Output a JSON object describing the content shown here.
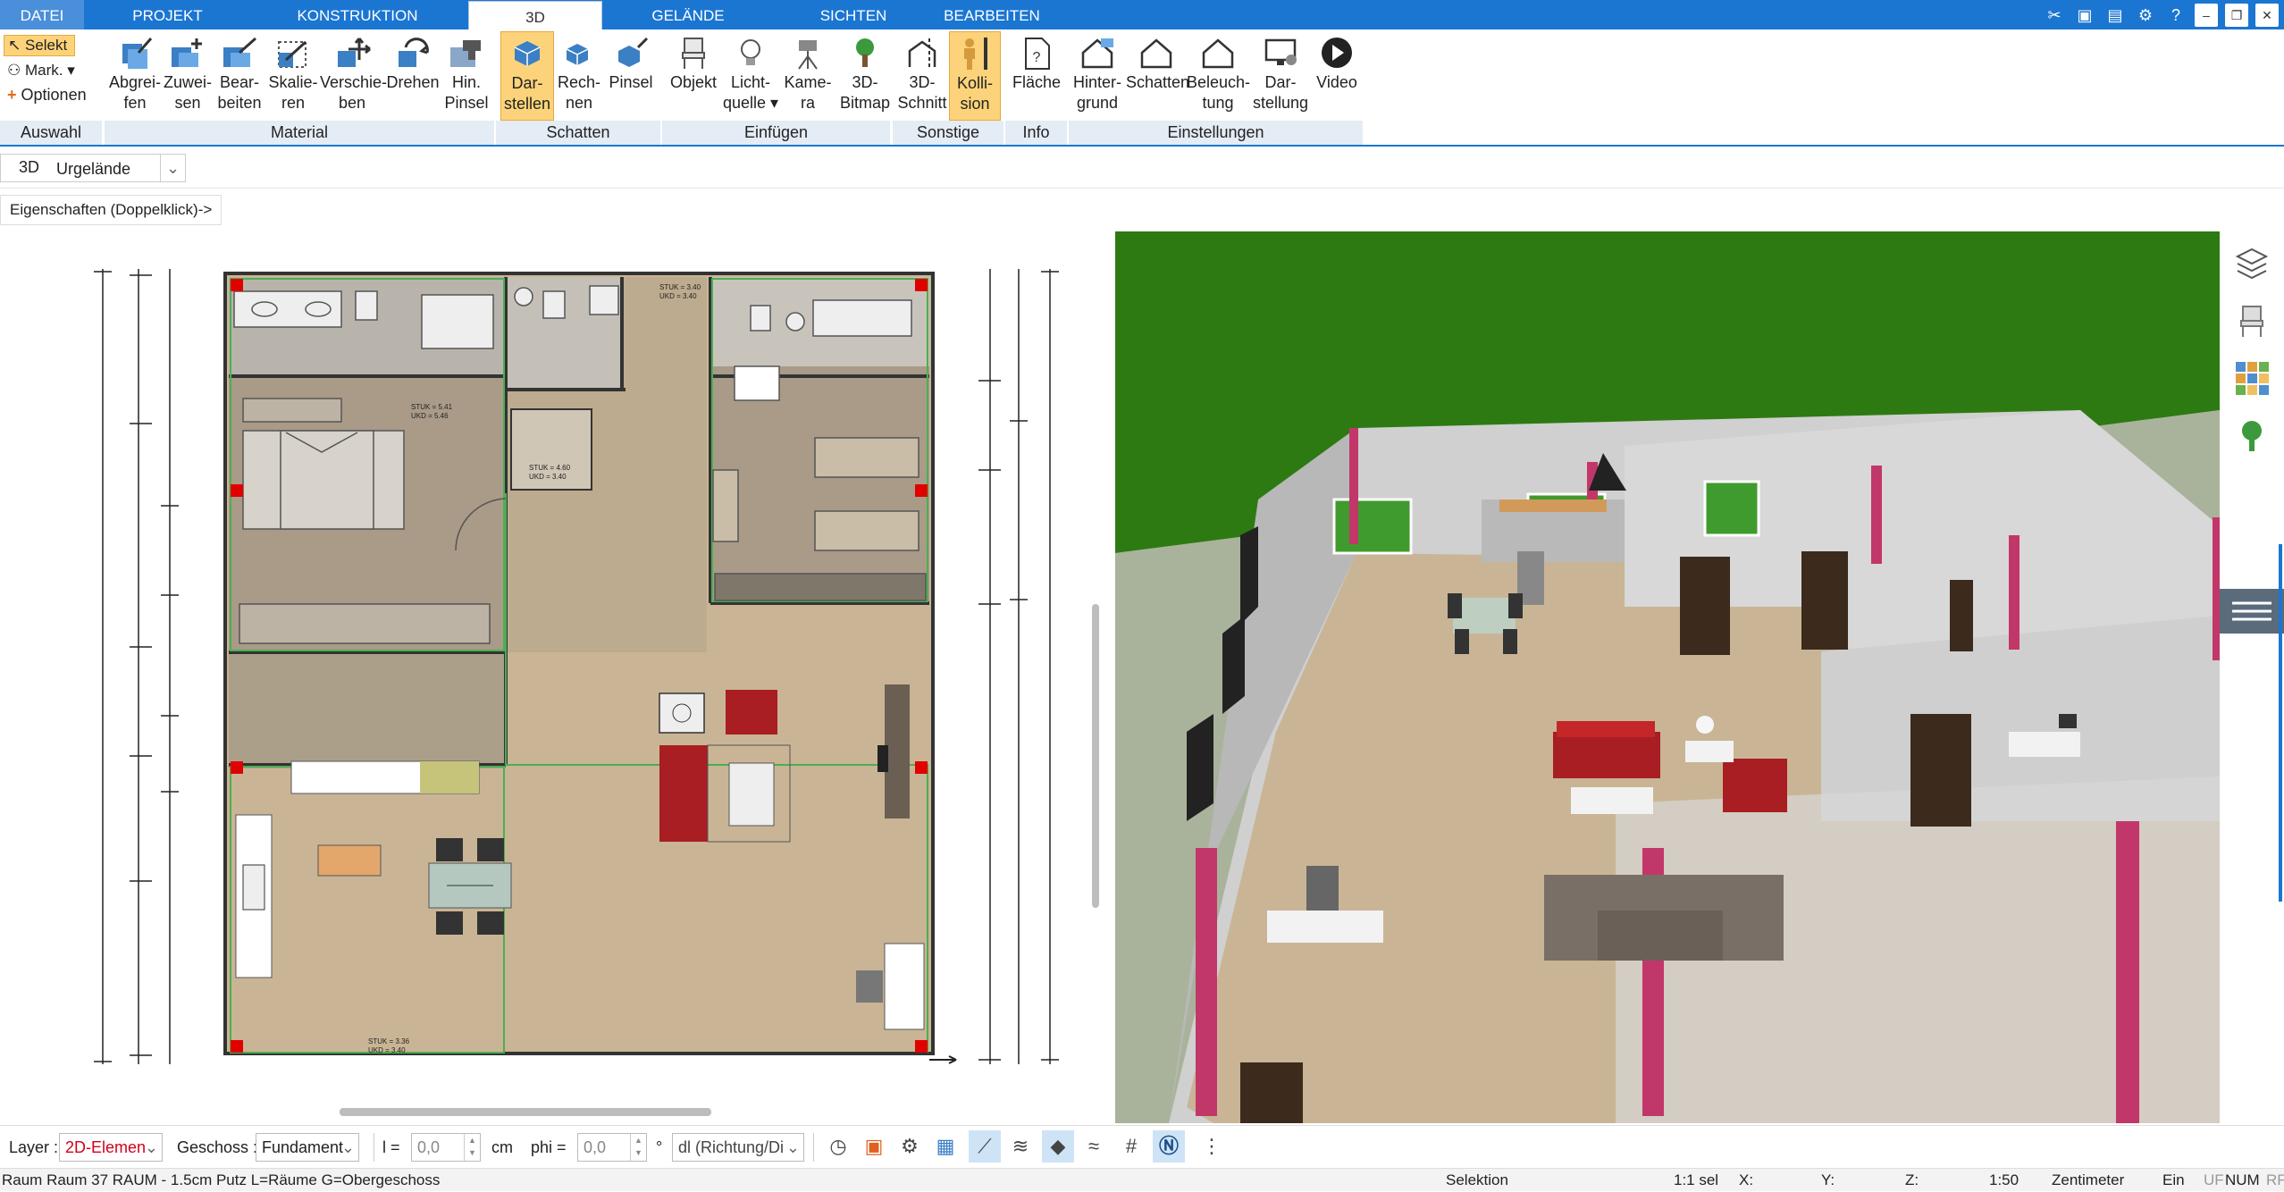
{
  "tabs": {
    "file": "DATEI",
    "projekt": "PROJEKT",
    "konstruktion": "KONSTRUKTION",
    "d3": "3D",
    "gelaende": "GELÄNDE",
    "sichten": "SICHTEN",
    "bearbeiten": "BEARBEITEN"
  },
  "auswahl": {
    "selekt": "Selekt",
    "mark": "Mark.",
    "optionen": "Optionen",
    "group": "Auswahl"
  },
  "material": {
    "b1a": "Abgrei-",
    "b1b": "fen",
    "b2a": "Zuwei-",
    "b2b": "sen",
    "b3a": "Bear-",
    "b3b": "beiten",
    "b4a": "Skalie-",
    "b4b": "ren",
    "b5a": "Verschie-",
    "b5b": "ben",
    "b6a": "Drehen",
    "b7a": "Hin.",
    "b7b": "Pinsel",
    "group": "Material"
  },
  "schatten": {
    "b1a": "Dar-",
    "b1b": "stellen",
    "b2a": "Rech-",
    "b2b": "nen",
    "b3a": "Pinsel",
    "group": "Schatten"
  },
  "einfuegen": {
    "b1a": "Objekt",
    "b2a": "Licht-",
    "b2b": "quelle",
    "b3a": "Kame-",
    "b3b": "ra",
    "b4a": "3D-",
    "b4b": "Bitmap",
    "group": "Einfügen"
  },
  "sonstige": {
    "b1a": "3D-",
    "b1b": "Schnitt",
    "b2a": "Kolli-",
    "b2b": "sion",
    "group": "Sonstige"
  },
  "info": {
    "b1a": "Fläche",
    "group": "Info"
  },
  "einstellungen": {
    "b1a": "Hinter-",
    "b1b": "grund",
    "b2a": "Schatten",
    "b3a": "Beleuch-",
    "b3b": "tung",
    "b4a": "Dar-",
    "b4b": "stellung",
    "b5a": "Video",
    "group": "Einstellungen"
  },
  "ctx": {
    "mode": "3D",
    "layer": "Urgelände"
  },
  "props": {
    "label": "Eigenschaften (Doppelklick)->"
  },
  "bottom": {
    "layer_label": "Layer :",
    "layer_value": "2D-Elemen",
    "geschoss_label": "Geschoss :",
    "geschoss_value": "Fundament",
    "l_label": "l =",
    "l_value": "0,0",
    "l_unit": "cm",
    "phi_label": "phi =",
    "phi_value": "0,0",
    "phi_unit": "°",
    "dl_value": "dl (Richtung/Di"
  },
  "status": {
    "left": "Raum Raum 37 RAUM - 1.5cm Putz L=Räume G=Obergeschoss",
    "mode": "Selektion",
    "sel": "1:1 sel",
    "x": "X:",
    "y": "Y:",
    "z": "Z:",
    "scale": "1:50",
    "unit": "Zentimeter",
    "ein": "Ein",
    "uf": "UF",
    "num": "NUM",
    "rf": "RF"
  },
  "colors": {
    "accent": "#1b76d2",
    "highlight": "#fcd37a",
    "grass": "#2d7a12",
    "floor": "#c9b595",
    "pink": "#c2376a"
  },
  "plan_labels": [
    "STUK = 3.40",
    "UKD = 3.40",
    "STUK = 5.41",
    "UKD = 5.46",
    "STUK = 4.60",
    "UKD = 3.40",
    "STUK = 3.36",
    "UKD = 3.40"
  ]
}
